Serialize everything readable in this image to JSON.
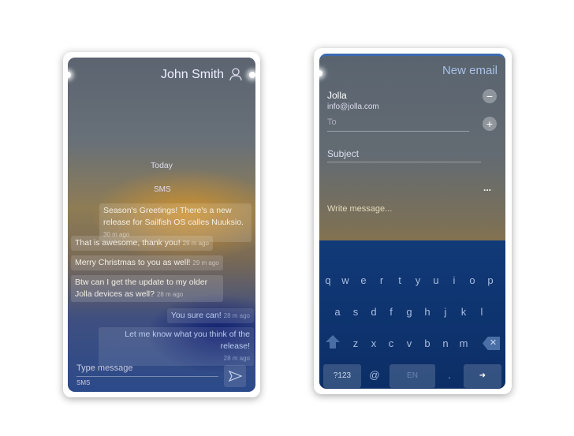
{
  "sms": {
    "contact_name": "John Smith",
    "day_label": "Today",
    "channel_label": "SMS",
    "messages": [
      {
        "text": "Season's Greetings! There's a new release for Sailfish OS calles Nuuksio.",
        "time": "30 m ago",
        "direction": "incoming"
      },
      {
        "text": "That is awesome, thank you!",
        "time": "29 m ago",
        "direction": "outgoing"
      },
      {
        "text": "Merry Christmas to you as well!",
        "time": "29 m ago",
        "direction": "outgoing"
      },
      {
        "text": "Btw can I get the update to my older Jolla devices as well?",
        "time": "28 m ago",
        "direction": "outgoing"
      },
      {
        "text": "You sure can!",
        "time": "28 m ago",
        "direction": "incoming"
      },
      {
        "text": "Let me know what you think of the release!",
        "time": "28 m ago",
        "direction": "incoming"
      }
    ],
    "input_placeholder": "Type message",
    "input_channel": "SMS"
  },
  "email": {
    "title": "New email",
    "from_name": "Jolla",
    "from_address": "info@jolla.com",
    "to_placeholder": "To",
    "subject_placeholder": "Subject",
    "more_label": "...",
    "body_placeholder": "Write message..."
  },
  "keyboard": {
    "row1": [
      "q",
      "w",
      "e",
      "r",
      "t",
      "y",
      "u",
      "i",
      "o",
      "p"
    ],
    "row2": [
      "a",
      "s",
      "d",
      "f",
      "g",
      "h",
      "j",
      "k",
      "l"
    ],
    "row3": [
      "z",
      "x",
      "c",
      "v",
      "b",
      "n",
      "m"
    ],
    "symbols_label": "?123",
    "at_label": "@",
    "language_label": "EN",
    "period_label": ".",
    "enter_label": "➜",
    "backspace_label": "✕"
  },
  "colors": {
    "accent": "#b9cdf0",
    "keyboard_bg": "#0f3470"
  }
}
